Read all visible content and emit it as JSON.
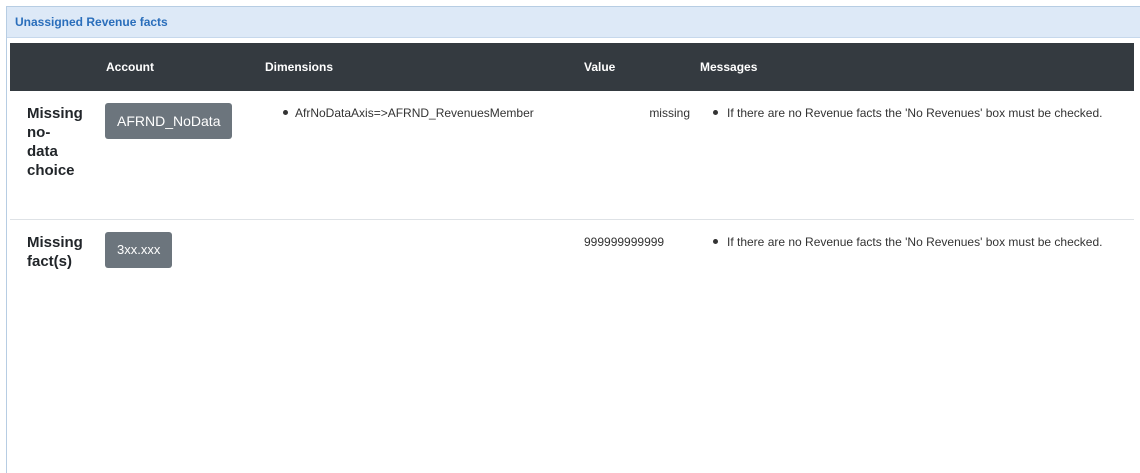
{
  "panel": {
    "title": "Unassigned Revenue facts"
  },
  "table": {
    "headers": {
      "rowlabel": "",
      "account": "Account",
      "dimensions": "Dimensions",
      "value": "Value",
      "messages": "Messages"
    },
    "rows": [
      {
        "label": "Missing no-data choice",
        "label_lines": [
          "Missing",
          "no-",
          "data",
          "choice"
        ],
        "account": "AFRND_NoData",
        "dimensions": [
          "AfrNoDataAxis=>AFRND_RevenuesMember"
        ],
        "value": "missing",
        "messages": [
          "If there are no Revenue facts the 'No Revenues' box must be checked."
        ]
      },
      {
        "label": "Missing fact(s)",
        "label_lines": [
          "Missing",
          "fact(s)"
        ],
        "account": "3xx.xxx",
        "dimensions": [],
        "value": "999999999999",
        "messages": [
          "If there are no Revenue facts the 'No Revenues' box must be checked."
        ]
      }
    ]
  },
  "colors": {
    "header_bg": "#343a40",
    "panel_header_bg": "#dde9f7",
    "panel_title": "#2a6ebb",
    "account_button_bg": "#6c757d"
  }
}
